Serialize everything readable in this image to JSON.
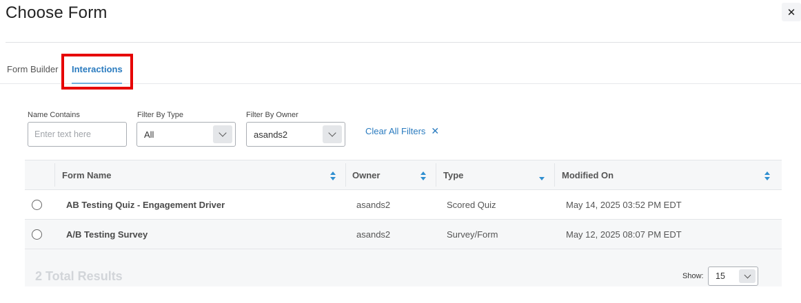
{
  "dialog": {
    "title": "Choose Form",
    "close_icon": "close-icon"
  },
  "tabs": [
    {
      "label": "Form Builder",
      "active": false
    },
    {
      "label": "Interactions",
      "active": true
    }
  ],
  "filters": {
    "name_contains": {
      "label": "Name Contains",
      "placeholder": "Enter text here",
      "value": ""
    },
    "type": {
      "label": "Filter By Type",
      "value": "All"
    },
    "owner": {
      "label": "Filter By Owner",
      "value": "asands2"
    },
    "clear_label": "Clear All Filters",
    "clear_icon": "close-icon"
  },
  "table": {
    "columns": [
      "Form Name",
      "Owner",
      "Type",
      "Modified On"
    ],
    "rows": [
      {
        "name": "AB Testing Quiz - Engagement Driver",
        "owner": "asands2",
        "type": "Scored Quiz",
        "modified": "May 14, 2025 03:52 PM EDT"
      },
      {
        "name": "A/B Testing Survey",
        "owner": "asands2",
        "type": "Survey/Form",
        "modified": "May 12, 2025 08:07 PM EDT"
      }
    ],
    "total_results": "2 Total Results",
    "show_label": "Show:",
    "show_value": "15"
  },
  "colors": {
    "accent": "#2a7bbf",
    "highlight": "#e60000"
  }
}
